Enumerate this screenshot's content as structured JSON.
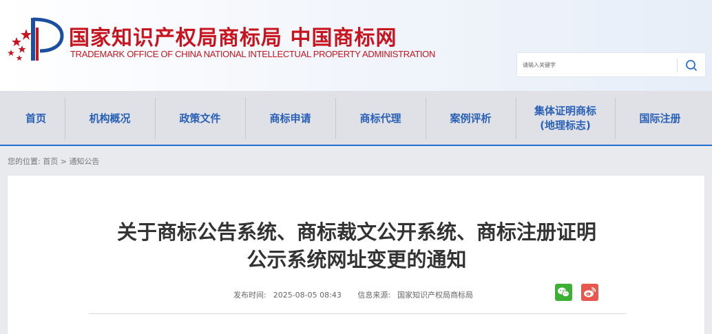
{
  "header": {
    "site_name_cn": "国家知识产权局商标局 中国商标网",
    "site_name_en": "TRADEMARK OFFICE OF CHINA NATIONAL INTELLECTUAL PROPERTY ADMINISTRATION",
    "brand_color": "#c8141e"
  },
  "search": {
    "placeholder": "请输入关键字",
    "icon": "search-icon"
  },
  "nav": {
    "items": [
      {
        "label": "首页"
      },
      {
        "label": "机构概况"
      },
      {
        "label": "政策文件"
      },
      {
        "label": "商标申请"
      },
      {
        "label": "商标代理"
      },
      {
        "label": "案例评析"
      },
      {
        "label_line1": "集体证明商标",
        "label_line2": "(地理标志)"
      },
      {
        "label": "国际注册"
      }
    ],
    "accent_color": "#2960b8"
  },
  "breadcrumb": {
    "prefix": "您的位置:",
    "home": "首页",
    "separator": ">",
    "current": "通知公告"
  },
  "article": {
    "title_line1": "关于商标公告系统、商标裁文公开系统、商标注册证明",
    "title_line2": "公示系统网址变更的通知",
    "publish_label": "发布时间:",
    "publish_time": "2025-08-05 08:43",
    "source_label": "信息来源:",
    "source": "国家知识产权局商标局"
  },
  "share": {
    "wechat_icon": "wechat-icon",
    "weibo_icon": "weibo-icon",
    "wechat_color": "#3cb034",
    "weibo_color": "#e8574d"
  }
}
